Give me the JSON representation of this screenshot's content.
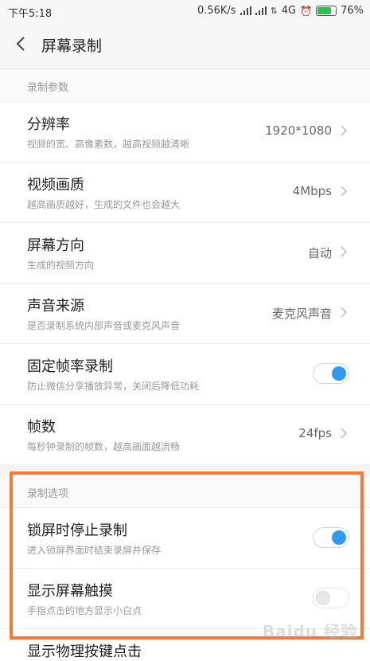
{
  "status_bar": {
    "time": "下午5:18",
    "speed": "0.56K/s",
    "network": "4G",
    "battery": "76%",
    "battery_level": 0.76,
    "icons": [
      "signal-icon",
      "signal-icon",
      "hd-icon",
      "alarm-icon",
      "battery-icon"
    ]
  },
  "header": {
    "title": "屏幕录制",
    "back_icon": "chevron-left-icon"
  },
  "section_params": {
    "label": "录制参数",
    "rows": [
      {
        "title": "分辨率",
        "subtitle": "视频的宽、高像素数，越高视频越清晰",
        "value": "1920*1080"
      },
      {
        "title": "视频画质",
        "subtitle": "越高画质越好，生成的文件也会越大",
        "value": "4Mbps"
      },
      {
        "title": "屏幕方向",
        "subtitle": "生成的视频方向",
        "value": "自动"
      },
      {
        "title": "声音来源",
        "subtitle": "是否录制系统内部声音或麦克风声音",
        "value": "麦克风声音"
      },
      {
        "title": "固定帧率录制",
        "subtitle": "防止微信分享播放异常，关闭后降低功耗",
        "toggle": true
      },
      {
        "title": "帧数",
        "subtitle": "每秒钟录制的帧数，越高画面越流畅",
        "value": "24fps"
      }
    ]
  },
  "section_options": {
    "label": "录制选项",
    "rows": [
      {
        "title": "锁屏时停止录制",
        "subtitle": "进入锁屏界面时结束录屏并保存",
        "toggle": true
      },
      {
        "title": "显示屏幕触摸",
        "subtitle": "手指点击的地方显示小白点",
        "toggle": false
      },
      {
        "title": "显示物理按键点击",
        "subtitle": ""
      }
    ]
  },
  "highlight_color": "#f47a32",
  "accent_color": "#2f9af0",
  "watermark": "Baidu 经验"
}
